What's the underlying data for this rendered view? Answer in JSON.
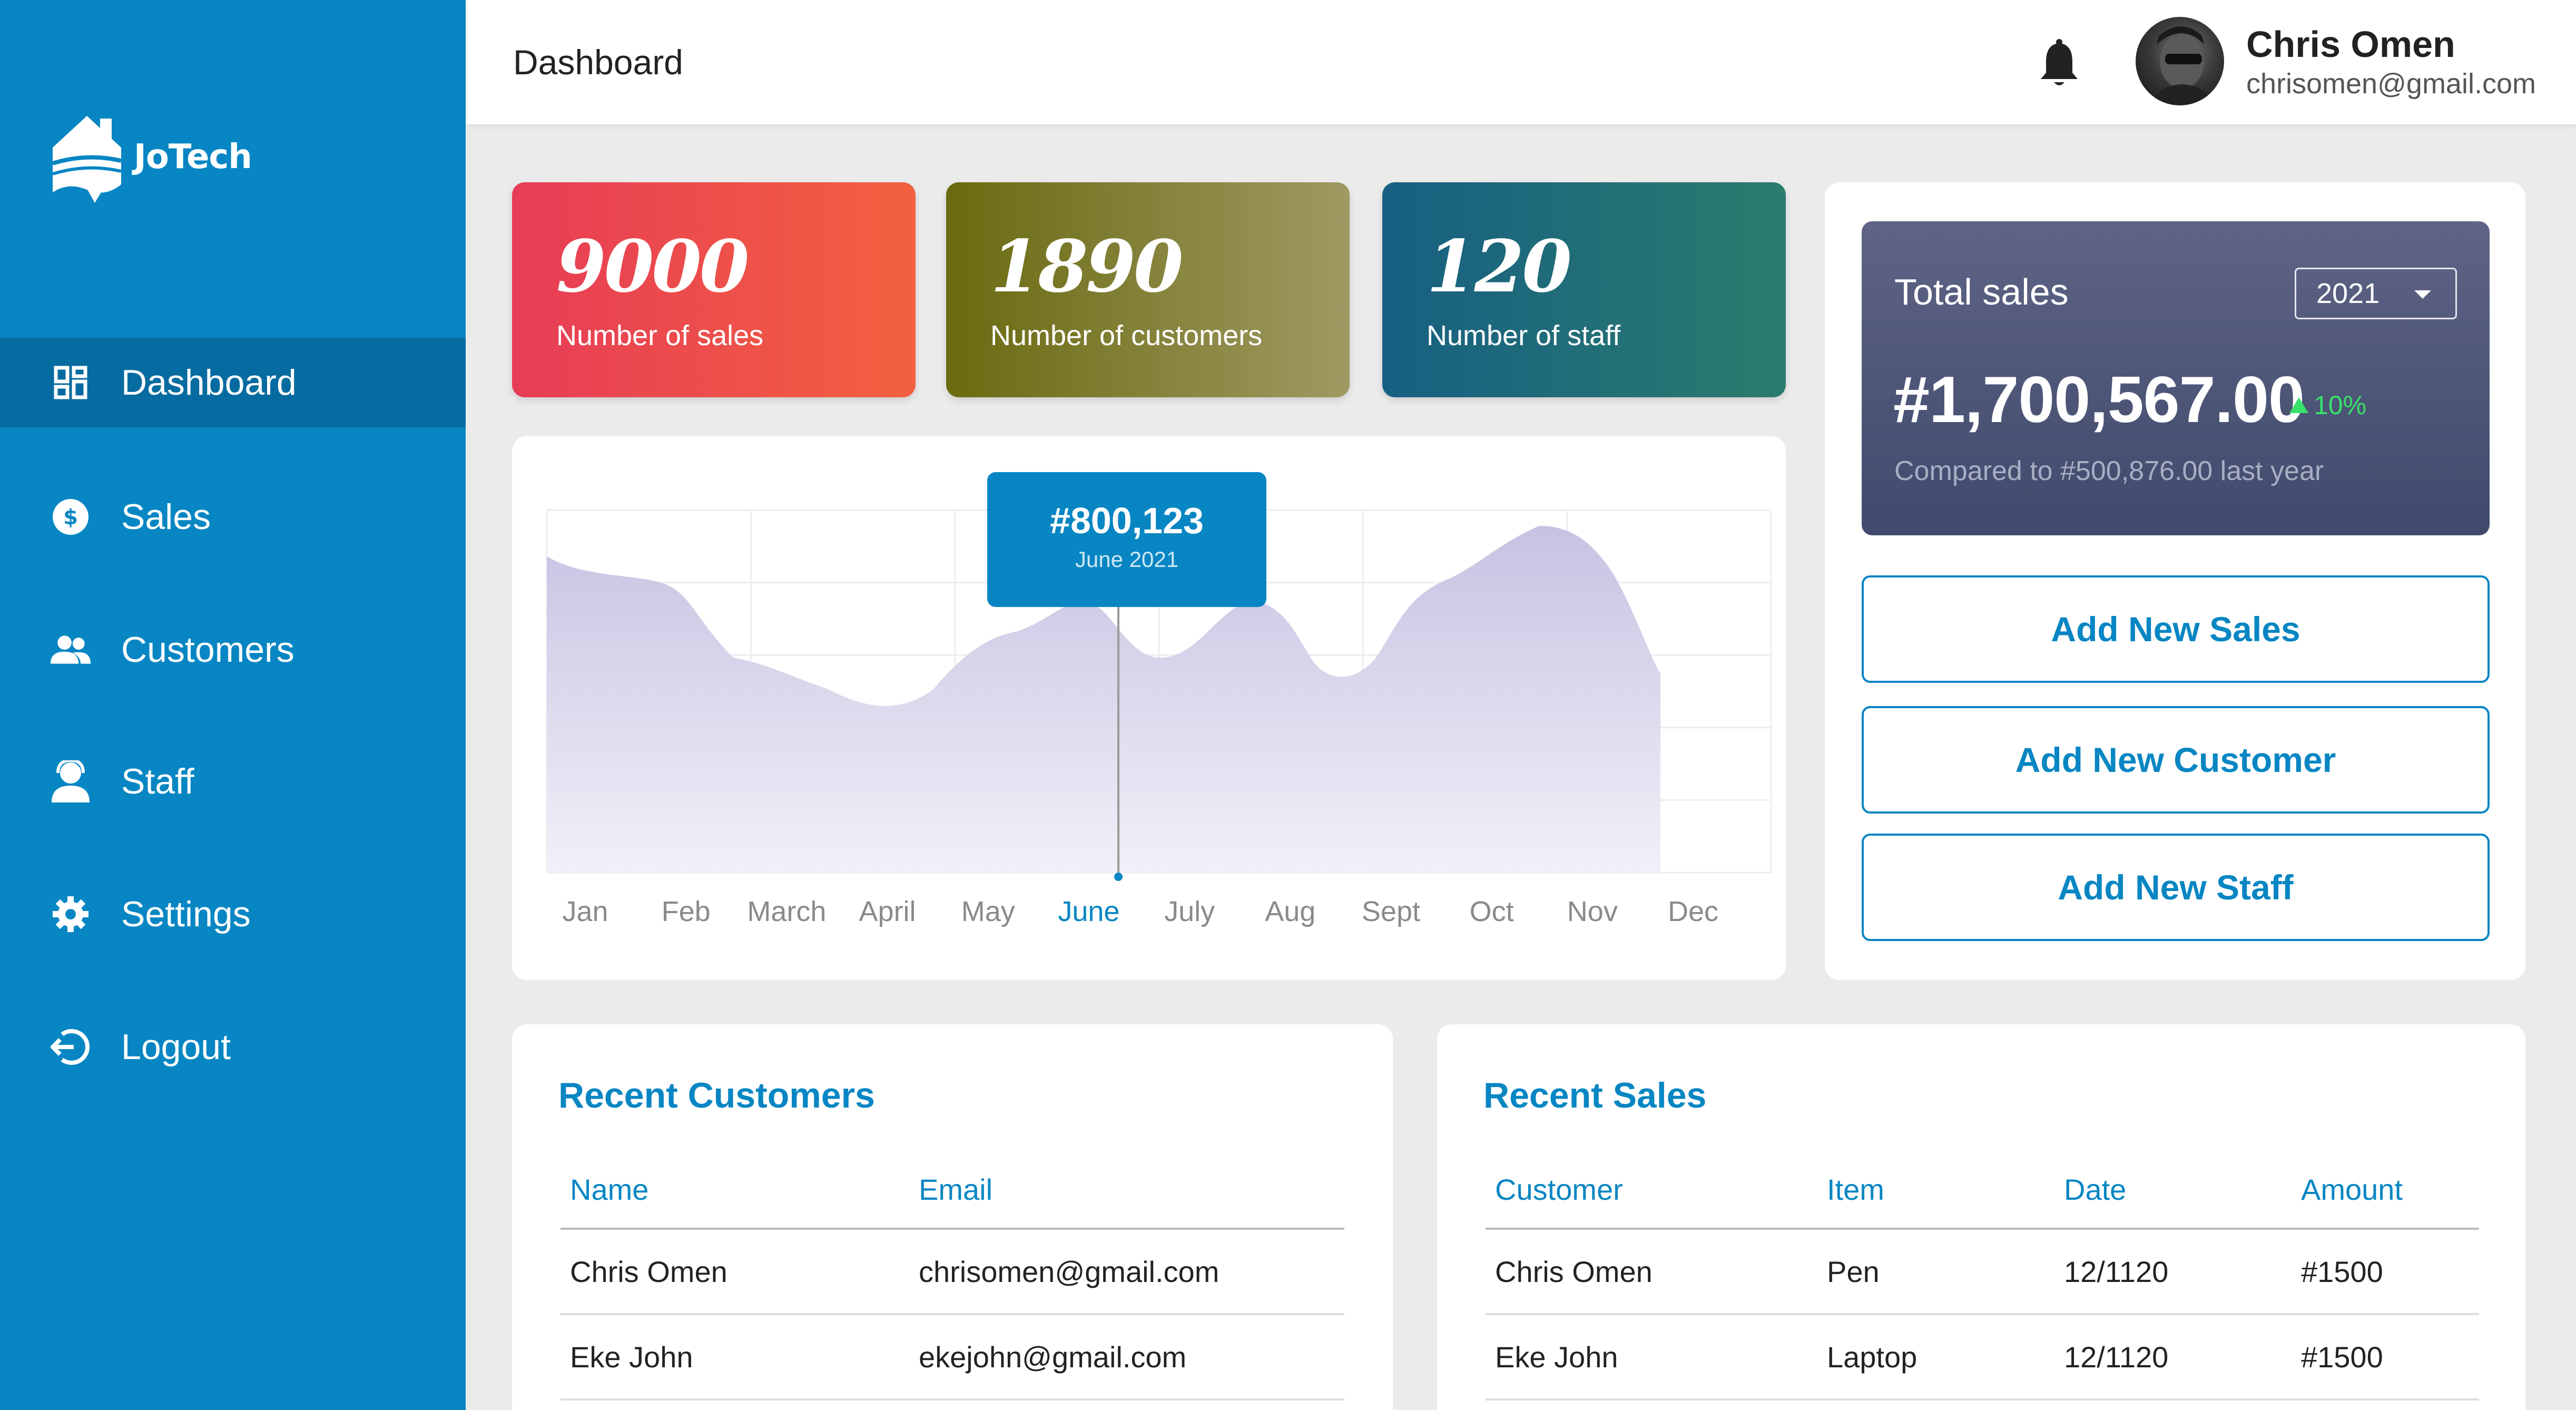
{
  "app": {
    "name": "JoTech"
  },
  "colors": {
    "primary": "#0786c3",
    "sidebar_active": "#066ba0",
    "chart_fill": "#cbc7e4",
    "positive": "#39e06a"
  },
  "sidebar": {
    "items": [
      {
        "label": "Dashboard",
        "icon": "dashboard-icon",
        "active": true
      },
      {
        "label": "Sales",
        "icon": "dollar-icon",
        "active": false
      },
      {
        "label": "Customers",
        "icon": "users-icon",
        "active": false
      },
      {
        "label": "Staff",
        "icon": "staff-icon",
        "active": false
      },
      {
        "label": "Settings",
        "icon": "gear-icon",
        "active": false
      },
      {
        "label": "Logout",
        "icon": "logout-icon",
        "active": false
      }
    ]
  },
  "header": {
    "title": "Dashboard",
    "notification_icon": "bell-icon",
    "user": {
      "name": "Chris Omen",
      "email": "chrisomen@gmail.com"
    }
  },
  "stats": [
    {
      "value": "9000",
      "label": "Number of sales"
    },
    {
      "value": "1890",
      "label": "Number of customers"
    },
    {
      "value": "120",
      "label": "Number of staff"
    }
  ],
  "total_sales": {
    "label": "Total sales",
    "year": "2021",
    "amount": "#1,700,567.00",
    "change": "10%",
    "compare": "Compared to #500,876.00 last year"
  },
  "actions": {
    "add_sales": "Add New Sales",
    "add_customer": "Add New Customer",
    "add_staff": "Add New Staff"
  },
  "chart_data": {
    "type": "area",
    "categories": [
      "Jan",
      "Feb",
      "March",
      "April",
      "May",
      "June",
      "July",
      "Aug",
      "Sept",
      "Oct",
      "Nov",
      "Dec"
    ],
    "highlight": {
      "category": "June",
      "value": "#800,123",
      "label": "June 2021"
    },
    "grid": true,
    "title": "",
    "xlabel": "",
    "ylabel": ""
  },
  "recent_customers": {
    "title": "Recent Customers",
    "columns": [
      "Name",
      "Email"
    ],
    "rows": [
      [
        "Chris Omen",
        "chrisomen@gmail.com"
      ],
      [
        "Eke John",
        "ekejohn@gmail.com"
      ]
    ]
  },
  "recent_sales": {
    "title": "Recent Sales",
    "columns": [
      "Customer",
      "Item",
      "Date",
      "Amount"
    ],
    "rows": [
      [
        "Chris Omen",
        "Pen",
        "12/1120",
        "#1500"
      ],
      [
        "Eke John",
        "Laptop",
        "12/1120",
        "#1500"
      ]
    ]
  }
}
